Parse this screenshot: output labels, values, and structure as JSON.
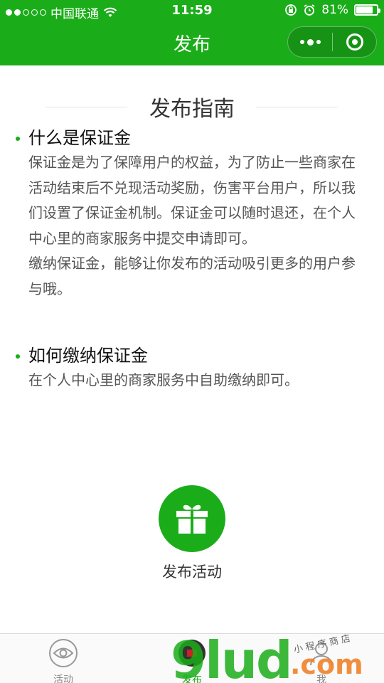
{
  "status_bar": {
    "carrier": "中国联通",
    "time": "11:59",
    "battery": "81%",
    "battery_level": 0.81,
    "signal_bars_filled": 2,
    "signal_bars_total": 5
  },
  "nav": {
    "title": "发布"
  },
  "guide": {
    "title": "发布指南",
    "sections": [
      {
        "title": "什么是保证金",
        "paragraphs": [
          "保证金是为了保障用户的权益，为了防止一些商家在活动结束后不兑现活动奖励，伤害平台用户，所以我们设置了保证金机制。保证金可以随时退还，在个人中心里的商家服务中提交申请即可。",
          "缴纳保证金，能够让你发布的活动吸引更多的用户参与哦。"
        ]
      },
      {
        "title": "如何缴纳保证金",
        "paragraphs": [
          "在个人中心里的商家服务中自助缴纳即可。"
        ]
      }
    ]
  },
  "publish_button": {
    "label": "发布活动",
    "icon": "gift-icon"
  },
  "tabbar": {
    "tabs": [
      {
        "label": "活动",
        "icon": "eye-icon",
        "active": false
      },
      {
        "label": "发布",
        "icon": "publish-icon",
        "active": true
      },
      {
        "label": "我",
        "icon": "user-icon",
        "active": false
      }
    ]
  },
  "watermark": {
    "main": "9lud",
    "suffix": ".com",
    "small": "小程序商店"
  },
  "colors": {
    "brand_green": "#1aad19",
    "watermark_orange": "#f08228"
  }
}
